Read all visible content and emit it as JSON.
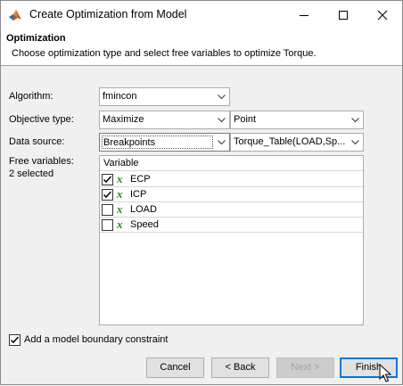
{
  "window": {
    "title": "Create Optimization from Model"
  },
  "header": {
    "title": "Optimization",
    "description": "Choose optimization type and select free variables to optimize Torque."
  },
  "form": {
    "algorithm_label": "Algorithm:",
    "algorithm_value": "fmincon",
    "objective_label": "Objective type:",
    "objective_value": "Maximize",
    "objective_mode_value": "Point",
    "data_source_label": "Data source:",
    "data_source_value": "Breakpoints",
    "data_table_value": "Torque_Table(LOAD,Sp...",
    "free_variables_label": "Free variables:",
    "free_variables_count": "2 selected"
  },
  "variables_table": {
    "header": "Variable",
    "rows": [
      {
        "name": "ECP",
        "checked": true
      },
      {
        "name": "ICP",
        "checked": true
      },
      {
        "name": "LOAD",
        "checked": false
      },
      {
        "name": "Speed",
        "checked": false
      }
    ]
  },
  "boundary": {
    "label": "Add a model boundary constraint",
    "checked": true
  },
  "buttons": {
    "cancel": "Cancel",
    "back": "< Back",
    "next": "Next >",
    "finish": "Finish"
  },
  "icons": {
    "app": "matlab-icon",
    "variable": "x-variable-icon"
  },
  "colors": {
    "accent": "#0078d7",
    "variable_icon": "#1b8a1b"
  }
}
